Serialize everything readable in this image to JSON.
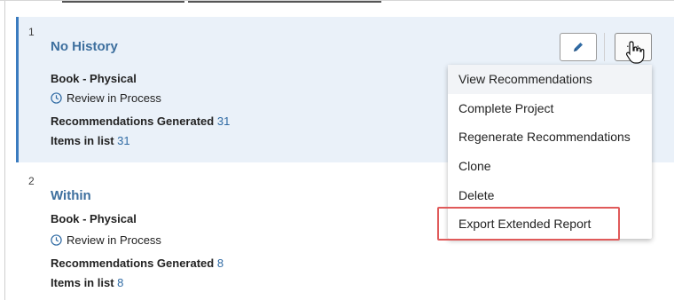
{
  "items": [
    {
      "index": "1",
      "title": "No History",
      "format": "Book - Physical",
      "status": "Review in Process",
      "rec_label": "Recommendations Generated",
      "rec_count": "31",
      "items_label": "Items in list",
      "items_count": "31"
    },
    {
      "index": "2",
      "title": "Within",
      "format": "Book - Physical",
      "status": "Review in Process",
      "rec_label": "Recommendations Generated",
      "rec_count": "8",
      "items_label": "Items in list",
      "items_count": "8"
    }
  ],
  "actions": {
    "edit_icon": "pencil-icon",
    "more_label": "···"
  },
  "menu": [
    "View Recommendations",
    "Complete Project",
    "Regenerate Recommendations",
    "Clone",
    "Delete",
    "Export Extended Report"
  ],
  "colors": {
    "accent": "#3a7bbf",
    "title": "#3d6f9e",
    "selected_bg": "#eaf1f9",
    "highlight": "#e05a5a"
  }
}
